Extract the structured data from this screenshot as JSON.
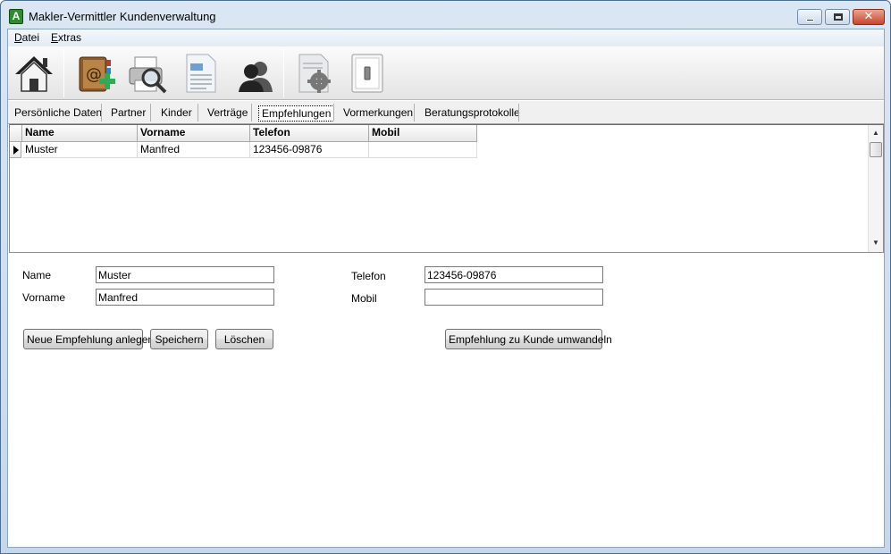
{
  "window": {
    "title": "Makler-Vermittler Kundenverwaltung",
    "app_icon_letter": "A",
    "close_glyph": "✕"
  },
  "menu": {
    "items": [
      {
        "label": "Datei",
        "mnemonic": "D"
      },
      {
        "label": "Extras",
        "mnemonic": "E"
      }
    ]
  },
  "toolbar": {
    "icons": [
      "home-icon",
      "address-book-add-icon",
      "print-preview-icon",
      "document-icon",
      "contacts-icon",
      "settings-icon",
      "switch-icon"
    ]
  },
  "tabs": {
    "items": [
      "Persönliche Daten",
      "Partner",
      "Kinder",
      "Verträge",
      "Empfehlungen",
      "Vormerkungen",
      "Beratungsprotokolle"
    ],
    "active": "Empfehlungen"
  },
  "grid": {
    "columns": [
      "Name",
      "Vorname",
      "Telefon",
      "Mobil"
    ],
    "rows": [
      {
        "name": "Muster",
        "vorname": "Manfred",
        "telefon": "123456-09876",
        "mobil": ""
      }
    ]
  },
  "form": {
    "name_label": "Name",
    "name_value": "Muster",
    "vorname_label": "Vorname",
    "vorname_value": "Manfred",
    "telefon_label": "Telefon",
    "telefon_value": "123456-09876",
    "mobil_label": "Mobil",
    "mobil_value": ""
  },
  "buttons": {
    "new": "Neue Empfehlung anlegen",
    "save": "Speichern",
    "delete": "Löschen",
    "convert": "Empfehlung zu Kunde umwandeln"
  }
}
